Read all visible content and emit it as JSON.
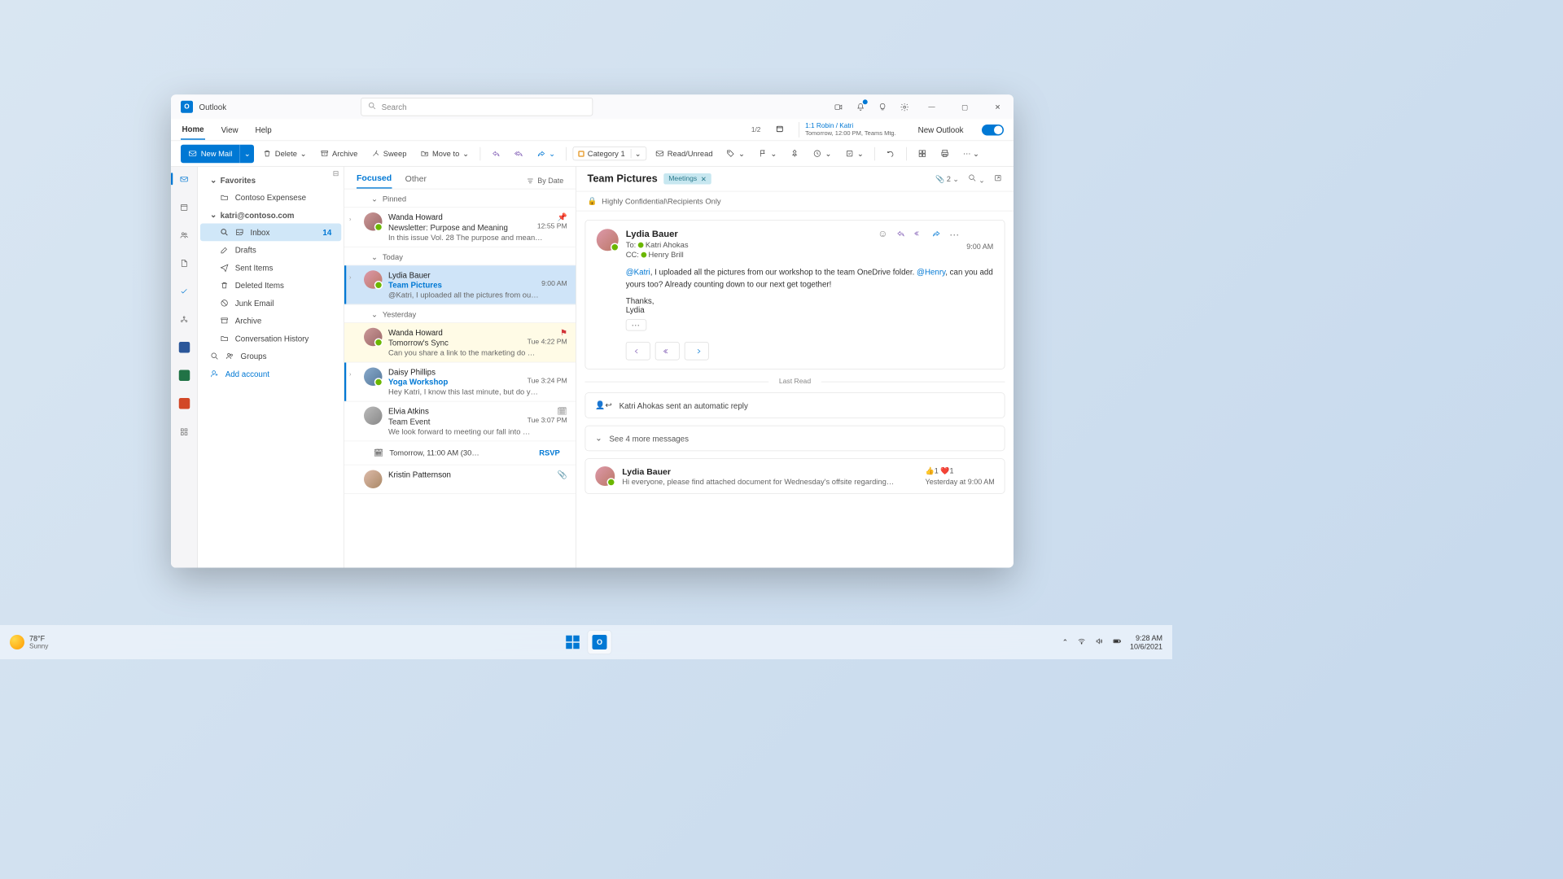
{
  "app": {
    "title": "Outlook",
    "search_placeholder": "Search"
  },
  "window_controls": {
    "min": "—",
    "max": "▢",
    "close": "✕"
  },
  "tabs": {
    "home": "Home",
    "view": "View",
    "help": "Help"
  },
  "calendar_peek": {
    "counter": "1/2",
    "line1": "1:1 Robin / Katri",
    "line2": "Tomorrow, 12:00 PM, Teams Mtg."
  },
  "new_outlook_label": "New Outlook",
  "ribbon": {
    "new_mail": "New Mail",
    "delete": "Delete",
    "archive": "Archive",
    "sweep": "Sweep",
    "move_to": "Move to",
    "category": "Category 1",
    "read_unread": "Read/Unread"
  },
  "folders": {
    "favorites": "Favorites",
    "fav_items": [
      "Contoso Expensese"
    ],
    "account": "katri@contoso.com",
    "items": [
      {
        "name": "Inbox",
        "count": "14",
        "sel": true,
        "icon": "inbox"
      },
      {
        "name": "Drafts",
        "icon": "drafts"
      },
      {
        "name": "Sent Items",
        "icon": "sent"
      },
      {
        "name": "Deleted Items",
        "icon": "trash"
      },
      {
        "name": "Junk Email",
        "icon": "junk"
      },
      {
        "name": "Archive",
        "icon": "archive"
      },
      {
        "name": "Conversation History",
        "icon": "folder"
      }
    ],
    "groups": "Groups",
    "add_account": "Add account"
  },
  "msglist": {
    "tab_focused": "Focused",
    "tab_other": "Other",
    "sort": "By Date",
    "grp_pinned": "Pinned",
    "grp_today": "Today",
    "grp_yesterday": "Yesterday",
    "items": [
      {
        "from": "Wanda Howard",
        "subj": "Newsletter: Purpose and Meaning",
        "time": "12:55 PM",
        "prev": "In this issue Vol. 28 The purpose and mean…",
        "pinned": true
      },
      {
        "from": "Lydia Bauer",
        "subj": "Team Pictures",
        "time": "9:00 AM",
        "prev": "@Katri, I uploaded all the pictures from ou…",
        "sel": true
      },
      {
        "from": "Wanda Howard",
        "subj": "Tomorrow's Sync",
        "time": "Tue 4:22 PM",
        "prev": "Can you share a link to the marketing do …",
        "flag": true
      },
      {
        "from": "Daisy Phillips",
        "subj": "Yoga Workshop",
        "time": "Tue 3:24 PM",
        "prev": "Hey Katri, I know this last minute, but do y…",
        "unread": true
      },
      {
        "from": "Elvia Atkins",
        "subj": "Team Event",
        "time": "Tue 3:07 PM",
        "prev": "We look forward to meeting our fall into …",
        "cal": true
      },
      {
        "from": "Kristin Patternson",
        "subj": "",
        "time": "",
        "prev": "",
        "att": true
      }
    ],
    "cal_row": "Tomorrow, 11:00 AM (30…",
    "rsvp": "RSVP"
  },
  "reading": {
    "subject": "Team Pictures",
    "tag": "Meetings",
    "attachments": "2",
    "confidential": "Highly Confidential\\Recipients Only",
    "sender": "Lydia Bauer",
    "to_label": "To:",
    "to_name": "Katri Ahokas",
    "cc_label": "CC:",
    "cc_name": "Henry Brill",
    "time": "9:00 AM",
    "body_pre": "@Katri",
    "body_mid": ", I uploaded all the pictures from our workshop to the team OneDrive folder. ",
    "body_m2": "@Henry",
    "body_post": ", can you add yours too? Already counting down to our next get together!",
    "thanks": "Thanks,",
    "sig": "Lydia",
    "last_read": "Last Read",
    "auto_reply": "Katri Ahokas sent an automatic reply",
    "see_more": "See 4 more messages",
    "second_sender": "Lydia Bauer",
    "second_prev": "Hi everyone, please find attached document for Wednesday's offsite regarding…",
    "second_time": "Yesterday at 9:00 AM",
    "react1": "1",
    "react2": "1"
  },
  "taskbar": {
    "weather_temp": "78°F",
    "weather_cond": "Sunny",
    "time": "9:28 AM",
    "date": "10/6/2021"
  }
}
